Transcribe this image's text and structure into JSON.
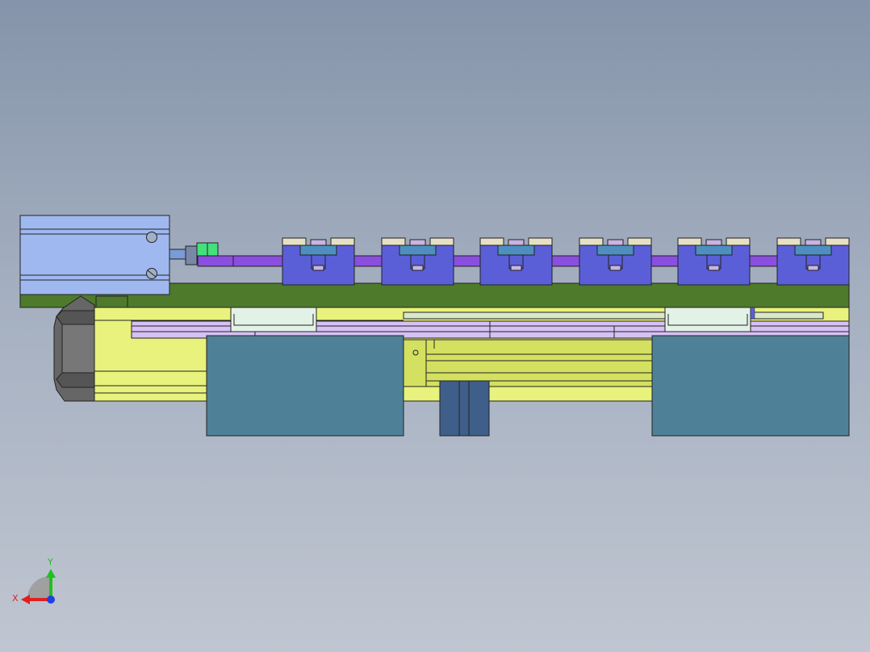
{
  "viewport": {
    "background_top": "#8594aa",
    "background_bottom": "#c0c6d1"
  },
  "colors": {
    "cylinder": "#a0b8f0",
    "clamp_block": "#5a5fd8",
    "clamp_cap": "#e6e0c4",
    "clamp_insert": "#4f8fc0",
    "clamp_screw": "#c8b4e0",
    "push_rod": "#8a4ee0",
    "base_plate": "#4e7a2c",
    "rail_body": "#e8f27c",
    "guide_rail": "#d6c0f4",
    "carriage": "#e2f2e6",
    "mount_plate": "#4e8198",
    "motor": "#666666",
    "fitting": "#44e07c",
    "foot": "#3f5f8a"
  },
  "clamps": {
    "count": 6
  },
  "triad": {
    "x_label": "X",
    "y_label": "Y",
    "x_icon": "arrow-x-icon",
    "y_icon": "arrow-y-icon",
    "z_icon": "dot-z-icon",
    "x_color": "#e02020",
    "y_color": "#20c020",
    "z_color": "#2040e0"
  }
}
